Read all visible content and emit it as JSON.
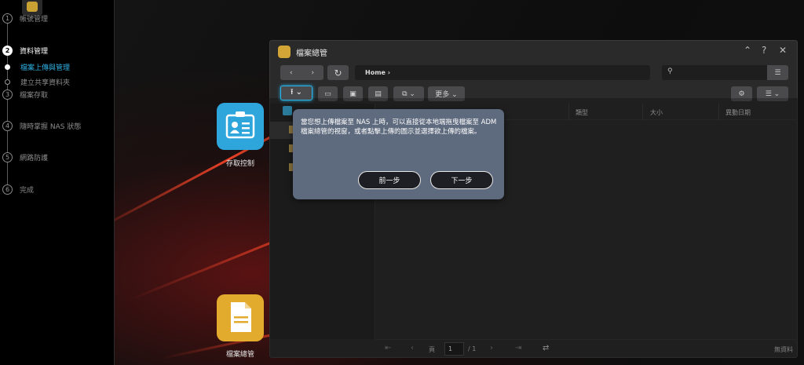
{
  "sidebar": {
    "steps": [
      {
        "num": "1",
        "label": "帳號管理"
      },
      {
        "num": "2",
        "label": "資料管理"
      },
      {
        "num": "3",
        "label": "檔案存取"
      },
      {
        "num": "4",
        "label": "隨時掌握 NAS 狀態"
      },
      {
        "num": "5",
        "label": "網路防護"
      },
      {
        "num": "6",
        "label": "完成"
      }
    ],
    "substeps": [
      {
        "label": "檔案上傳與管理"
      },
      {
        "label": "建立共享資料夾"
      }
    ]
  },
  "desktop": {
    "icons": [
      {
        "label": "存取控制",
        "color": "#2ea6dc"
      },
      {
        "label": "檔案總管",
        "color": "#e3ab2e"
      }
    ]
  },
  "window": {
    "title": "檔案總管",
    "controls": {
      "minimize": "⌃",
      "help": "?",
      "close": "✕"
    },
    "path": "Home ›",
    "toolbar": {
      "more_label": "更多 ⌄"
    },
    "columns": {
      "type": "類型",
      "size": "大小",
      "modified": "異動日期"
    },
    "pager": {
      "page_prefix": "頁",
      "page_value": "1",
      "page_total": "/ 1",
      "status": "無資料"
    }
  },
  "dialog": {
    "message": "當您想上傳檔案至 NAS 上時，可以直接從本地端拖曳檔案至 ADM 檔案總管的視窗，或者點擊上傳的圖示並選擇欲上傳的檔案。",
    "prev_label": "前一步",
    "next_label": "下一步"
  },
  "colors": {
    "accent": "#29b6ea",
    "dialog_bg": "#5e6a7d"
  }
}
